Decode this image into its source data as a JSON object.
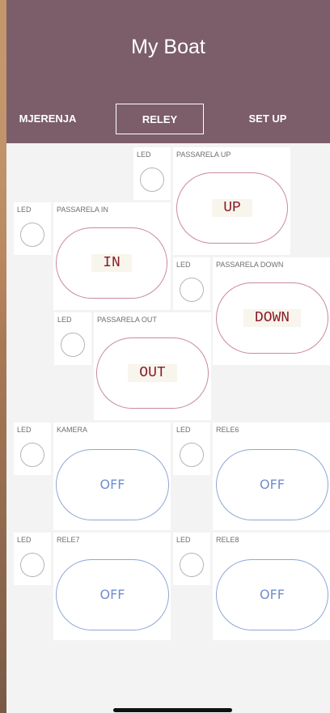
{
  "header": {
    "title": "My Boat"
  },
  "tabs": [
    {
      "label": "MJERENJA"
    },
    {
      "label": "RELEY"
    },
    {
      "label": "SET UP"
    }
  ],
  "led_label": "LED",
  "widgets": {
    "passarela_up": {
      "label": "PASSARELA UP",
      "button": "UP"
    },
    "passarela_in": {
      "label": "PASSARELA IN",
      "button": "IN"
    },
    "passarela_down": {
      "label": "PASSARELA DOWN",
      "button": "DOWN"
    },
    "passarela_out": {
      "label": "PASSARELA OUT",
      "button": "OUT"
    },
    "kamera": {
      "label": "KAMERA",
      "button": "OFF"
    },
    "rele6": {
      "label": "RELE6",
      "button": "OFF"
    },
    "rele7": {
      "label": "RELE7",
      "button": "OFF"
    },
    "rele8": {
      "label": "RELE8",
      "button": "OFF"
    }
  },
  "colors": {
    "header": "#7c5d6a",
    "pill_red": "#c98a9a",
    "pill_blue": "#8fa6d6",
    "button_text_red": "#8a1c2a"
  }
}
